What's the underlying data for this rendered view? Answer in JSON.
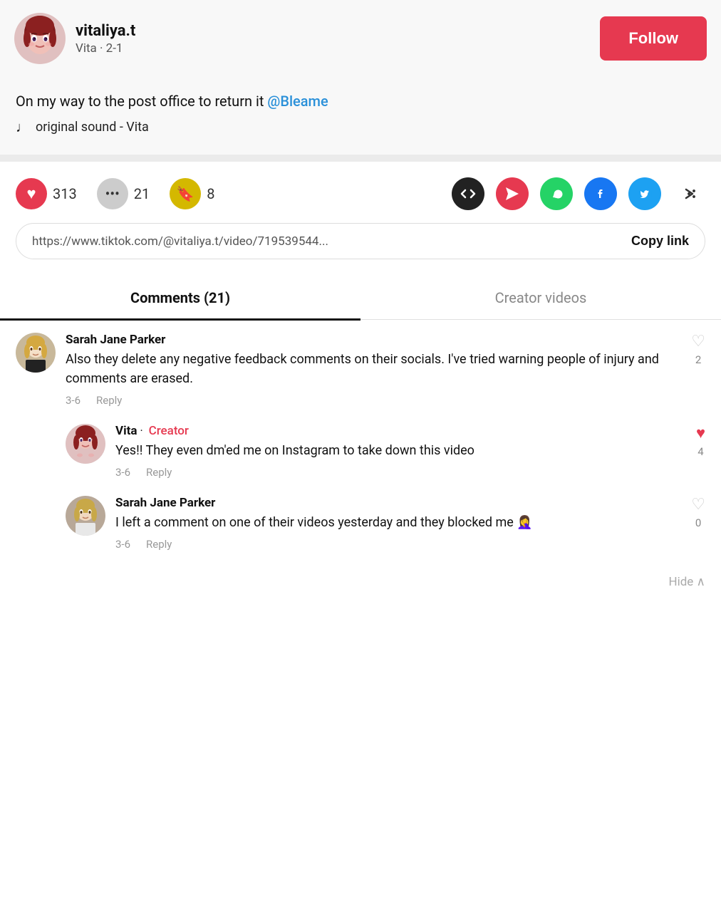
{
  "creator": {
    "username": "vitaliya.t",
    "subtitle": "Vita · 2-1",
    "follow_label": "Follow",
    "avatar_alt": "vitaliya.t avatar"
  },
  "post": {
    "caption": "On my way to the post office to return it",
    "mention": "@Bleame",
    "sound": "original sound - Vita"
  },
  "actions": {
    "likes": "313",
    "comments": "21",
    "bookmarks": "8"
  },
  "share": {
    "url": "https://www.tiktok.com/@vitaliya.t/video/719539544...",
    "copy_label": "Copy link"
  },
  "tabs": [
    {
      "label": "Comments (21)",
      "active": true
    },
    {
      "label": "Creator videos",
      "active": false
    }
  ],
  "comments": [
    {
      "id": "c1",
      "author": "Sarah Jane Parker",
      "is_creator": false,
      "text": "Also they delete any negative feedback comments on their socials. I've tried warning people of injury and comments are erased.",
      "date": "3-6",
      "likes": 2,
      "liked": false,
      "avatar_type": "photo_blonde"
    },
    {
      "id": "c2",
      "author": "Vita",
      "creator_badge": "Creator",
      "is_creator": true,
      "text": "Yes!! They even dm'ed me on Instagram to take down this video",
      "date": "3-6",
      "likes": 4,
      "liked": true,
      "avatar_type": "creator",
      "is_reply": true
    },
    {
      "id": "c3",
      "author": "Sarah Jane Parker",
      "is_creator": false,
      "text": "I left a comment on one of their videos yesterday and they blocked me 🤦‍♀️",
      "date": "3-6",
      "likes": 0,
      "liked": false,
      "avatar_type": "photo_blonde2",
      "is_reply": true
    }
  ],
  "hide_label": "Hide"
}
